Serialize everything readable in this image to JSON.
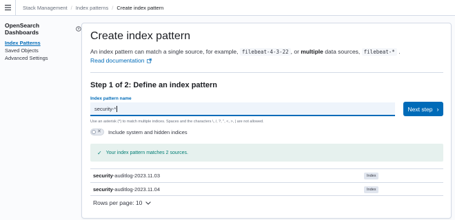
{
  "topbar": {
    "menu_icon": "menu-icon",
    "breadcrumbs": [
      "Stack Management",
      "Index patterns",
      "Create index pattern"
    ]
  },
  "sidebar": {
    "title": "OpenSearch Dashboards",
    "help_icon": "question-icon",
    "items": [
      {
        "label": "Index Patterns",
        "active": true
      },
      {
        "label": "Saved Objects",
        "active": false
      },
      {
        "label": "Advanced Settings",
        "active": false
      }
    ]
  },
  "main": {
    "title": "Create index pattern",
    "desc_1": "An index pattern can match a single source, for example,",
    "desc_code1": "filebeat-4-3-22",
    "desc_2": ", or",
    "desc_bold": "multiple",
    "desc_3": "data sources,",
    "desc_code2": "filebeat-*",
    "desc_4": ".",
    "read_doc": "Read documentation",
    "step_title": "Step 1 of 2: Define an index pattern",
    "field_label": "Index pattern name",
    "input_value": "security-*",
    "next_label": "Next step",
    "help_text": "Use an asterisk (*) to match multiple indices. Spaces and the characters \\, /, ?, \", <, >, | are not allowed.",
    "toggle_label": "Include system and hidden indices",
    "toggle_on": false,
    "callout": "Your index pattern matches 2 sources.",
    "rows": [
      {
        "bold": "security",
        "rest": "-auditlog-2023.11.03",
        "badge": "Index"
      },
      {
        "bold": "security",
        "rest": "-auditlog-2023.11.04",
        "badge": "Index"
      }
    ],
    "rows_per_page_label": "Rows per page: 10"
  },
  "colors": {
    "accent": "#006bb8",
    "success": "#017d73"
  }
}
